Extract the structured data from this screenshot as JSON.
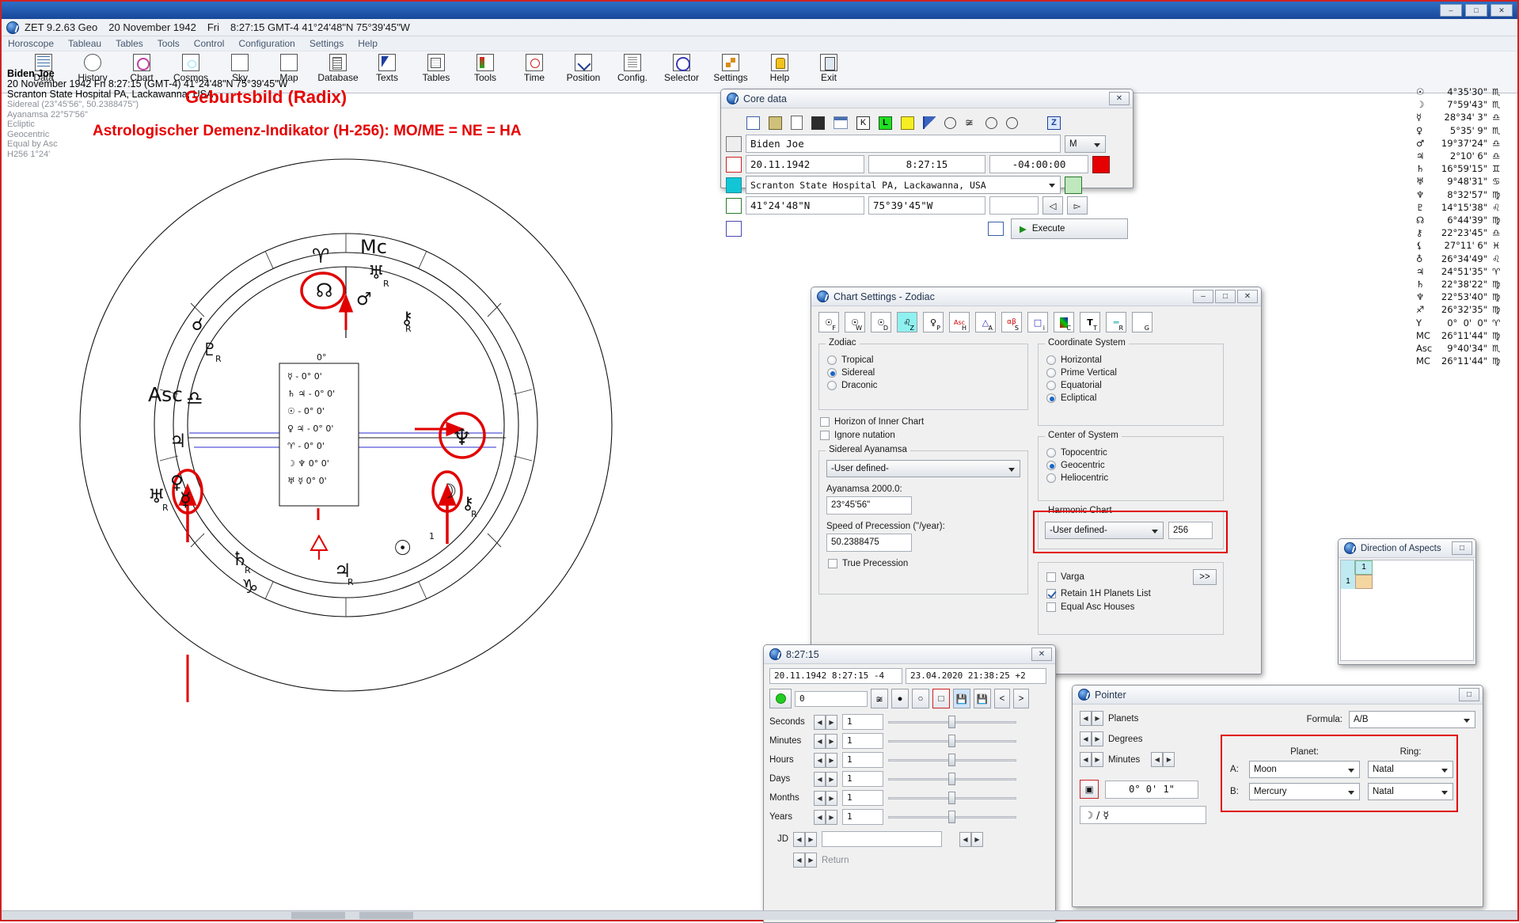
{
  "window": {
    "title_segments": [
      "ZET 9.2.63 Geo",
      "20 November 1942",
      "Fri",
      "8:27:15 GMT-4 41°24'48\"N  75°39'45\"W"
    ],
    "buttons": [
      "–",
      "□",
      "✕"
    ]
  },
  "menubar": [
    "Horoscope",
    "Tableau",
    "Tables",
    "Tools",
    "Control",
    "Configuration",
    "Settings",
    "Help"
  ],
  "toolbar": [
    {
      "label": "Data",
      "icon": "data-icon"
    },
    {
      "label": "History",
      "icon": "history-icon"
    },
    {
      "label": "Chart",
      "icon": "chart-icon"
    },
    {
      "label": "Cosmos",
      "icon": "cosmos-icon"
    },
    {
      "label": "Sky",
      "icon": "sky-icon"
    },
    {
      "label": "Map",
      "icon": "map-icon"
    },
    {
      "label": "Database",
      "icon": "database-icon"
    },
    {
      "label": "Texts",
      "icon": "texts-icon"
    },
    {
      "label": "Tables",
      "icon": "tables-icon"
    },
    {
      "label": "Tools",
      "icon": "tools-icon"
    },
    {
      "label": "Time",
      "icon": "time-icon"
    },
    {
      "label": "Position",
      "icon": "position-icon"
    },
    {
      "label": "Config.",
      "icon": "config-icon"
    },
    {
      "label": "Selector",
      "icon": "selector-icon"
    },
    {
      "label": "Settings",
      "icon": "settings-icon"
    },
    {
      "label": "Help",
      "icon": "help-icon"
    },
    {
      "label": "Exit",
      "icon": "exit-icon"
    }
  ],
  "chart_info": {
    "name": "Biden Joe",
    "datetime": "20 November 1942  Fri   8:27:15 (GMT-4) 41°24'48\"N  75°39'45\"W",
    "place": "Scranton State Hospital PA, Lackawanna, USA",
    "details": [
      "Sidereal (23°45'56\", 50.2388475\")",
      "Ayanamsa 22°57'56\"",
      "Ecliptic",
      "Geocentric",
      "Equal by Asc",
      "H256   1°24'"
    ]
  },
  "annotations": {
    "title1": "Geburtsbild (Radix)",
    "title2": "Astrologischer Demenz-Indikator (H-256): MO/ME = NE = HA",
    "red": "#e60000"
  },
  "wheel": {
    "asc_label": "Asc",
    "mc_label": "Mc",
    "zero_label": "0°",
    "inner_table": [
      "☿  - 0° 0'",
      "♄ ♃ - 0° 0'",
      "♁ - 0° 0'",
      "♀ ♃ - 0° 0'",
      "♈ - 0° 0'",
      "☽ ♆ 0° 0'",
      "♅ ☿ 0° 0'"
    ]
  },
  "planet_list": [
    {
      "glyph": "☉",
      "deg": "4°35'30\"",
      "sign": "♏"
    },
    {
      "glyph": "☽",
      "deg": "7°59'43\"",
      "sign": "♏"
    },
    {
      "glyph": "☿",
      "deg": "28°34' 3\"",
      "sign": "♎"
    },
    {
      "glyph": "♀",
      "deg": "5°35' 9\"",
      "sign": "♏"
    },
    {
      "glyph": "♂",
      "deg": "19°37'24\"",
      "sign": "♎"
    },
    {
      "glyph": "♃",
      "deg": "2°10' 6\"",
      "sign": "♎"
    },
    {
      "glyph": "♄",
      "deg": "16°59'15\"",
      "sign": "♊"
    },
    {
      "glyph": "♅",
      "deg": "9°48'31\"",
      "sign": "♋"
    },
    {
      "glyph": "♆",
      "deg": "8°32'57\"",
      "sign": "♍"
    },
    {
      "glyph": "♇",
      "deg": "14°15'38\"",
      "sign": "♌"
    },
    {
      "glyph": "☊",
      "deg": "6°44'39\"",
      "sign": "♍"
    },
    {
      "glyph": "⚷",
      "deg": "22°23'45\"",
      "sign": "♎"
    },
    {
      "glyph": "⚸",
      "deg": "27°11' 6\"",
      "sign": "♓"
    },
    {
      "glyph": "♁",
      "deg": "26°34'49\"",
      "sign": "♌"
    },
    {
      "glyph": "♃",
      "deg": "24°51'35\"",
      "sign": "♈"
    },
    {
      "glyph": "♄",
      "deg": "22°38'22\"",
      "sign": "♍"
    },
    {
      "glyph": "♆",
      "deg": "22°53'40\"",
      "sign": "♍"
    },
    {
      "glyph": "♐",
      "deg": "26°32'35\"",
      "sign": "♍"
    },
    {
      "glyph": "Υ",
      "deg": "0°  0'  0\"",
      "sign": "♈"
    },
    {
      "glyph": "MC",
      "deg": "26°11'44\"",
      "sign": "♍"
    },
    {
      "glyph": "Asc",
      "deg": "9°40'34\"",
      "sign": "♏"
    },
    {
      "glyph": "MC",
      "deg": "26°11'44\"",
      "sign": "♍"
    }
  ],
  "core_data": {
    "title": "Core data",
    "win_buttons": [
      "✕"
    ],
    "toolbar_icons": [
      "copy-icon",
      "paste-icon",
      "new-icon",
      "save-icon",
      "calendar-icon",
      "K",
      "L",
      "S",
      "flag-icon",
      "globe-icon",
      "sync-icon",
      "sun-icon",
      "moon-icon",
      "Z"
    ],
    "name_value": "Biden Joe",
    "gender_value": "M",
    "date_value": "20.11.1942",
    "time_value": "8:27:15",
    "zone_value": "-04:00:00",
    "place_value": "Scranton State Hospital PA, Lackawanna, USA",
    "lat_value": "41°24'48\"N",
    "lon_value": "75°39'45\"W",
    "extra_value": "",
    "execute_label": "Execute"
  },
  "chart_settings": {
    "title": "Chart Settings - Zodiac",
    "win_buttons": [
      "–",
      "□",
      "✕"
    ],
    "tabs": [
      {
        "main": "☉",
        "sub": "F"
      },
      {
        "main": "☉",
        "sub": "W"
      },
      {
        "main": "☉",
        "sub": "D"
      },
      {
        "main": "♌",
        "sub": "Z",
        "selected": true
      },
      {
        "main": "♀",
        "sub": "P"
      },
      {
        "main": "Asc",
        "sub": "H"
      },
      {
        "main": "△",
        "sub": "A"
      },
      {
        "main": "αβ",
        "sub": "S"
      },
      {
        "main": "□",
        "sub": "i"
      },
      {
        "main": "▦",
        "sub": "C"
      },
      {
        "main": "T",
        "sub": "T"
      },
      {
        "main": "═",
        "sub": "R"
      },
      {
        "main": "",
        "sub": "G"
      }
    ],
    "zodiac": {
      "caption": "Zodiac",
      "options": [
        "Tropical",
        "Sidereal",
        "Draconic"
      ],
      "selected": "Sidereal"
    },
    "horizon_checkbox": {
      "label": "Horizon of Inner Chart",
      "checked": false
    },
    "nutation_checkbox": {
      "label": "Ignore nutation",
      "checked": false
    },
    "ayanamsa": {
      "caption": "Sidereal Ayanamsa",
      "select_value": "-User defined-",
      "label_2000": "Ayanamsa 2000.0:",
      "value_2000": "23°45'56\"",
      "label_speed": "Speed of Precession (\"/year):",
      "value_speed": "50.2388475",
      "true_precession": {
        "label": "True Precession",
        "checked": false
      }
    },
    "coordinate_system": {
      "caption": "Coordinate System",
      "options": [
        "Horizontal",
        "Prime Vertical",
        "Equatorial",
        "Ecliptical"
      ],
      "selected": "Ecliptical"
    },
    "center_of_system": {
      "caption": "Center of System",
      "options": [
        "Topocentric",
        "Geocentric",
        "Heliocentric"
      ],
      "selected": "Geocentric"
    },
    "harmonic": {
      "caption": "Harmonic Chart",
      "select_value": "-User defined-",
      "number_value": "256"
    },
    "varga": {
      "label": "Varga",
      "checked": false,
      "button": ">>"
    },
    "retain": {
      "label": "Retain 1H Planets List",
      "checked": true
    },
    "equal_asc": {
      "label": "Equal Asc Houses",
      "checked": false
    }
  },
  "direction_of_aspects": {
    "title": "Direction of Aspects",
    "win_buttons": [
      "□"
    ],
    "row1": "1",
    "row2": "1",
    "cell": "1"
  },
  "time_dialog": {
    "title": "8:27:15",
    "win_buttons": [
      "✕"
    ],
    "date_field": "20.11.1942  8:27:15  -4",
    "date_field2": "23.04.2020  21:38:25  +2",
    "zero_value": "0",
    "rows": [
      {
        "label": "Seconds",
        "value": "1"
      },
      {
        "label": "Minutes",
        "value": "1"
      },
      {
        "label": "Hours",
        "value": "1"
      },
      {
        "label": "Days",
        "value": "1"
      },
      {
        "label": "Months",
        "value": "1"
      },
      {
        "label": "Years",
        "value": "1"
      }
    ],
    "jd_label": "JD",
    "jd_value": "",
    "return_label": "Return",
    "nav": [
      "<",
      ">"
    ]
  },
  "pointer_dialog": {
    "title": "Pointer",
    "win_buttons": [
      "□"
    ],
    "rows": [
      "Planets",
      "Degrees",
      "Minutes"
    ],
    "formula_label": "Formula:",
    "formula_value": "A/B",
    "planet_col": "Planet:",
    "ring_col": "Ring:",
    "a_label": "A:",
    "a_planet": "Moon",
    "a_ring": "Natal",
    "b_label": "B:",
    "b_planet": "Mercury",
    "b_ring": "Natal",
    "coord_value": "0°  0'  1\"",
    "formula_display": "☽ / ☿"
  }
}
